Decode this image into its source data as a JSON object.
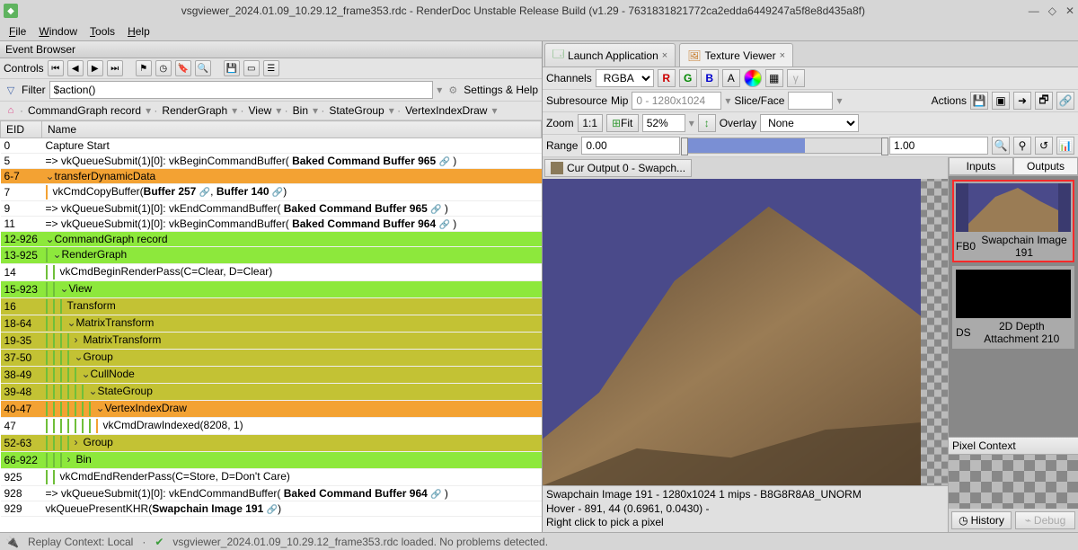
{
  "window": {
    "title": "vsgviewer_2024.01.09_10.29.12_frame353.rdc - RenderDoc Unstable Release Build (v1.29 - 7631831821772ca2edda6449247a5f8e8d435a8f)"
  },
  "menubar": [
    "File",
    "Window",
    "Tools",
    "Help"
  ],
  "event_browser": {
    "title": "Event Browser",
    "controls_label": "Controls",
    "filter_label": "Filter",
    "filter_value": "$action()",
    "settings_label": "Settings & Help",
    "breadcrumb": [
      "CommandGraph record",
      "RenderGraph",
      "View",
      "Bin",
      "StateGroup",
      "VertexIndexDraw"
    ],
    "columns": [
      "EID",
      "Name"
    ],
    "rows": [
      {
        "eid": "0",
        "cls": "row-white",
        "indent": 0,
        "chev": "",
        "text": "Capture Start"
      },
      {
        "eid": "5",
        "cls": "row-white",
        "indent": 0,
        "chev": "",
        "html": "=> vkQueueSubmit(1)[0]: vkBeginCommandBuffer( <b>Baked Command Buffer 965</b> <span class='link-icon'>🔗</span> )"
      },
      {
        "eid": "6-7",
        "cls": "row-orange",
        "indent": 0,
        "chev": "v",
        "text": "transferDynamicData"
      },
      {
        "eid": "7",
        "cls": "row-white",
        "indent": 1,
        "lines": [
          "orange"
        ],
        "chev": "",
        "html": "vkCmdCopyBuffer(<b>Buffer 257</b> <span class='link-icon'>🔗</span>,  <b>Buffer 140</b> <span class='link-icon'>🔗</span>)"
      },
      {
        "eid": "9",
        "cls": "row-white",
        "indent": 0,
        "chev": "",
        "html": "=> vkQueueSubmit(1)[0]: vkEndCommandBuffer( <b>Baked Command Buffer 965</b> <span class='link-icon'>🔗</span> )"
      },
      {
        "eid": "11",
        "cls": "row-white",
        "indent": 0,
        "chev": "",
        "html": "=> vkQueueSubmit(1)[0]: vkBeginCommandBuffer( <b>Baked Command Buffer 964</b> <span class='link-icon'>🔗</span> )"
      },
      {
        "eid": "12-926",
        "cls": "row-green",
        "indent": 0,
        "chev": "v",
        "text": "CommandGraph record"
      },
      {
        "eid": "13-925",
        "cls": "row-green",
        "indent": 1,
        "lines": [
          "g"
        ],
        "chev": "v",
        "text": "RenderGraph"
      },
      {
        "eid": "14",
        "cls": "row-white",
        "indent": 2,
        "lines": [
          "g",
          "g"
        ],
        "chev": "",
        "text": "vkCmdBeginRenderPass(C=Clear, D=Clear)"
      },
      {
        "eid": "15-923",
        "cls": "row-green",
        "indent": 2,
        "lines": [
          "g",
          "g"
        ],
        "chev": "v",
        "text": "View"
      },
      {
        "eid": "16",
        "cls": "row-olive",
        "indent": 3,
        "lines": [
          "g",
          "g",
          "g"
        ],
        "chev": "",
        "text": "Transform"
      },
      {
        "eid": "18-64",
        "cls": "row-olive",
        "indent": 3,
        "lines": [
          "g",
          "g",
          "g"
        ],
        "chev": "v",
        "text": "MatrixTransform"
      },
      {
        "eid": "19-35",
        "cls": "row-olive",
        "indent": 4,
        "lines": [
          "g",
          "g",
          "g",
          "g"
        ],
        "chev": ">",
        "text": "MatrixTransform"
      },
      {
        "eid": "37-50",
        "cls": "row-olive",
        "indent": 4,
        "lines": [
          "g",
          "g",
          "g",
          "g"
        ],
        "chev": "v",
        "text": "Group"
      },
      {
        "eid": "38-49",
        "cls": "row-olive",
        "indent": 5,
        "lines": [
          "g",
          "g",
          "g",
          "g",
          "g"
        ],
        "chev": "v",
        "text": "CullNode"
      },
      {
        "eid": "39-48",
        "cls": "row-olive",
        "indent": 6,
        "lines": [
          "g",
          "g",
          "g",
          "g",
          "g",
          "g"
        ],
        "chev": "v",
        "text": "StateGroup"
      },
      {
        "eid": "40-47",
        "cls": "row-orange",
        "indent": 7,
        "lines": [
          "g",
          "g",
          "g",
          "g",
          "g",
          "g",
          "g"
        ],
        "chev": "v",
        "text": "VertexIndexDraw"
      },
      {
        "eid": "47",
        "cls": "row-white",
        "indent": 8,
        "lines": [
          "g",
          "g",
          "g",
          "g",
          "g",
          "g",
          "g",
          "orange"
        ],
        "chev": "",
        "text": "vkCmdDrawIndexed(8208, 1)"
      },
      {
        "eid": "52-63",
        "cls": "row-olive",
        "indent": 4,
        "lines": [
          "g",
          "g",
          "g",
          "g"
        ],
        "chev": ">",
        "text": "Group"
      },
      {
        "eid": "66-922",
        "cls": "row-green",
        "indent": 3,
        "lines": [
          "g",
          "g",
          "g"
        ],
        "chev": ">",
        "text": "Bin"
      },
      {
        "eid": "925",
        "cls": "row-white",
        "indent": 2,
        "lines": [
          "g",
          "g"
        ],
        "chev": "",
        "text": "vkCmdEndRenderPass(C=Store, D=Don't Care)"
      },
      {
        "eid": "928",
        "cls": "row-white",
        "indent": 0,
        "chev": "",
        "html": "=> vkQueueSubmit(1)[0]: vkEndCommandBuffer( <b>Baked Command Buffer 964</b> <span class='link-icon'>🔗</span> )"
      },
      {
        "eid": "929",
        "cls": "row-white",
        "indent": 0,
        "chev": "",
        "html": "vkQueuePresentKHR(<b>Swapchain Image 191</b> <span class='link-icon'>🔗</span>)"
      }
    ]
  },
  "tabs": {
    "launch": "Launch Application",
    "texview": "Texture Viewer"
  },
  "tex": {
    "channels_label": "Channels",
    "channels_value": "RGBA",
    "ch_r": "R",
    "ch_g": "G",
    "ch_b": "B",
    "ch_a": "A",
    "subres_label": "Subresource",
    "mip_label": "Mip",
    "mip_value": "0 - 1280x1024",
    "slice_label": "Slice/Face",
    "actions_label": "Actions",
    "zoom_label": "Zoom",
    "zoom_11": "1:1",
    "zoom_fit": "Fit",
    "zoom_pct": "52%",
    "overlay_label": "Overlay",
    "overlay_value": "None",
    "range_label": "Range",
    "range_min": "0.00",
    "range_max": "1.00",
    "cur_output": "Cur Output 0 - Swapch...",
    "status1": "Swapchain Image 191 - 1280x1024 1 mips - B8G8R8A8_UNORM",
    "status2": "Hover -   891,   44 (0.6961, 0.0430) - ",
    "status3": "Right click to pick a pixel"
  },
  "side": {
    "inputs": "Inputs",
    "outputs": "Outputs",
    "out_fb0": "FB0",
    "out_fb0_name": "Swapchain Image 191",
    "out_ds": "DS",
    "out_ds_name": "2D Depth Attachment 210",
    "pixel_ctx": "Pixel Context",
    "history": "History",
    "debug": "Debug"
  },
  "statusbar": {
    "replay": "Replay Context: Local",
    "loaded": "vsgviewer_2024.01.09_10.29.12_frame353.rdc loaded. No problems detected."
  }
}
